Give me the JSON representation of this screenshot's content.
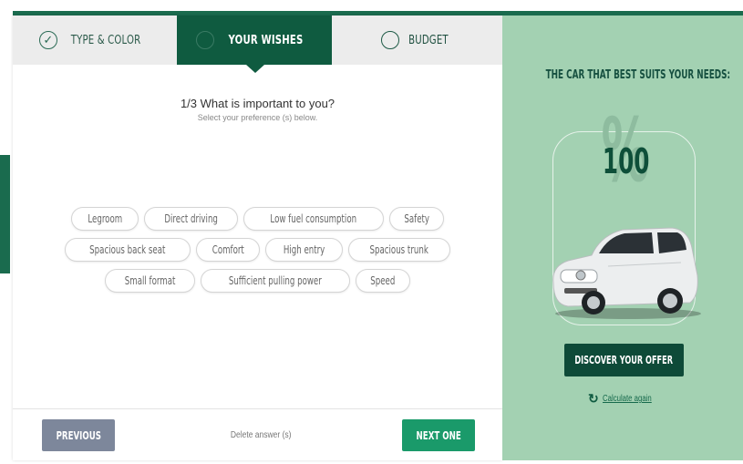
{
  "tabs": [
    {
      "label": "TYPE & COLOR",
      "state": "completed",
      "icon": "check-circle-icon"
    },
    {
      "label": "YOUR WISHES",
      "state": "active",
      "icon": "circle-icon"
    },
    {
      "label": "BUDGET",
      "state": "pending",
      "icon": "circle-icon"
    }
  ],
  "question": {
    "title": "1/3 What is important to you?",
    "subtitle": "Select your preference (s) below."
  },
  "options": [
    [
      "Legroom",
      "Direct driving",
      "Low fuel consumption",
      "Safety"
    ],
    [
      "Spacious back seat",
      "Comfort",
      "High entry",
      "Spacious trunk"
    ],
    [
      "Small format",
      "Sufficient pulling power",
      "Speed"
    ]
  ],
  "footer": {
    "previous_label": "PREVIOUS",
    "delete_label": "Delete answer (s)",
    "next_label": "NEXT ONE"
  },
  "side": {
    "title": "THE CAR THAT BEST SUITS YOUR NEEDS:",
    "percent_symbol": "%",
    "score": "100",
    "offer_label": "DISCOVER YOUR OFFER",
    "recalc_icon": "refresh-icon",
    "recalc_label": "Calculate again"
  },
  "colors": {
    "brand_dark": "#0f5b40",
    "brand_green": "#1a9a6a",
    "side_bg": "#a3d1b2",
    "prev_button": "#7d879b"
  }
}
